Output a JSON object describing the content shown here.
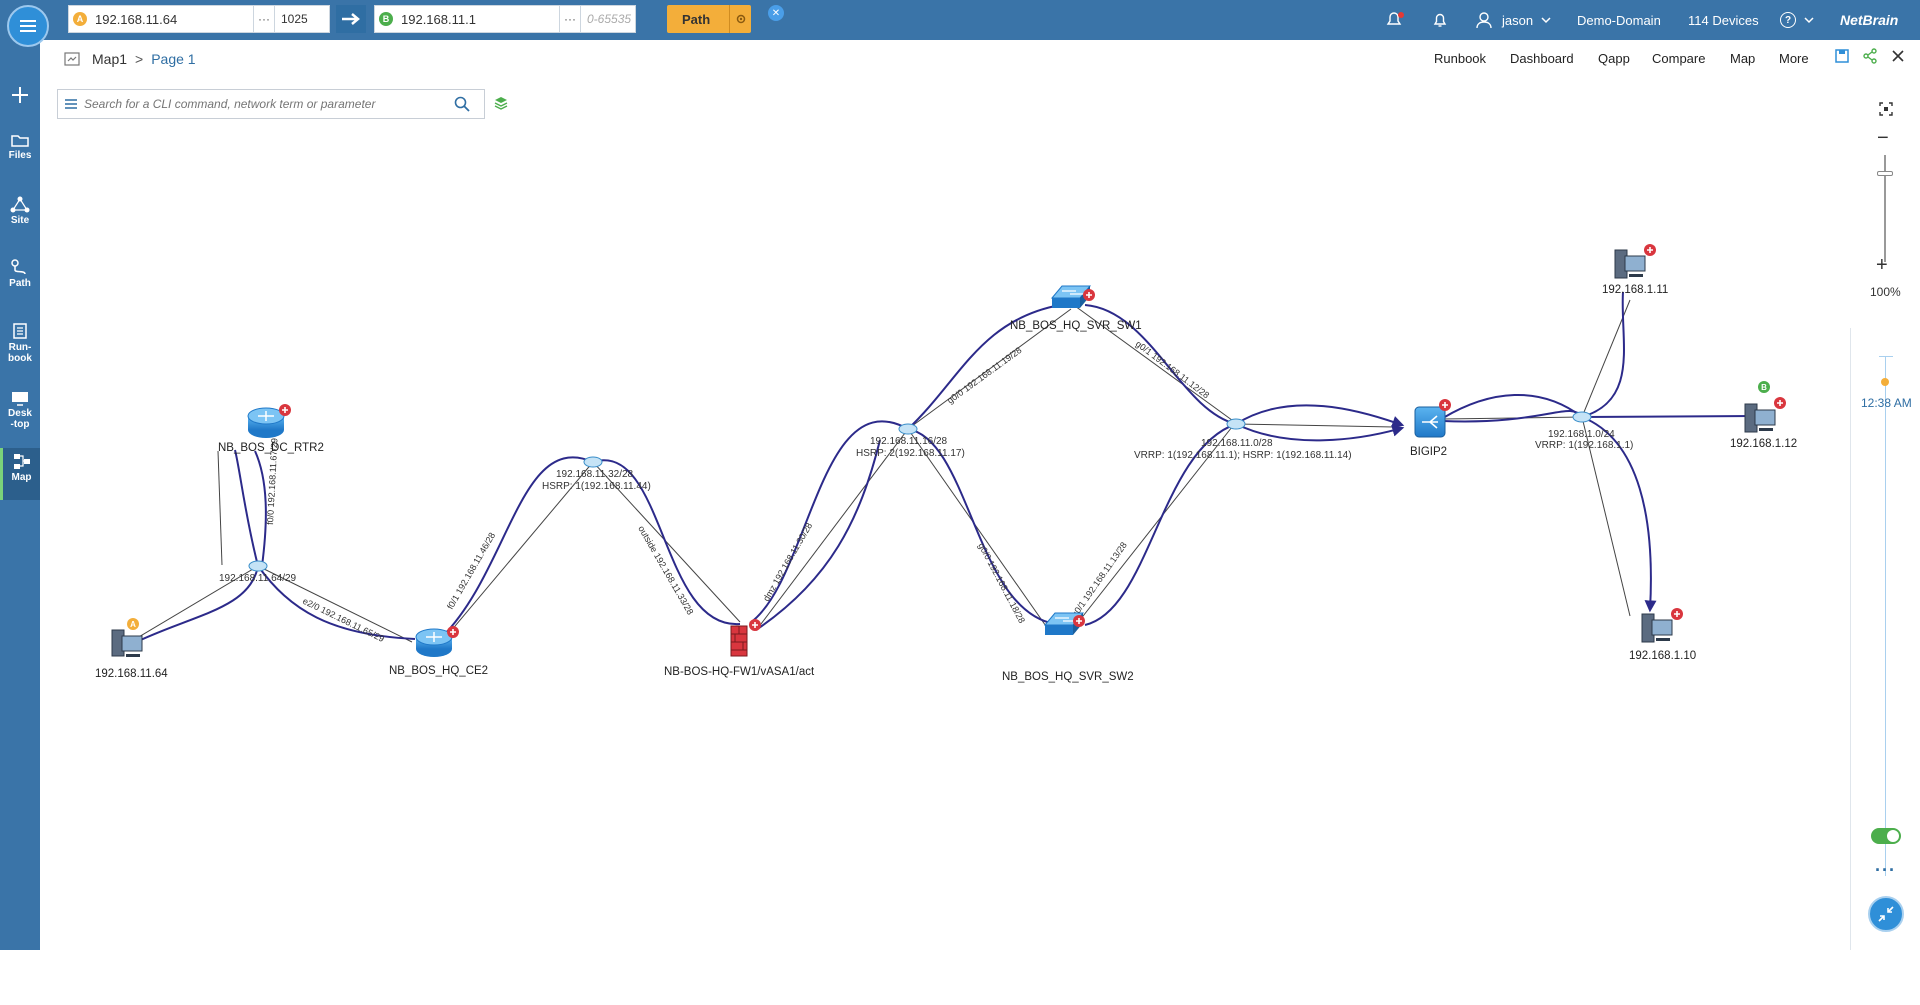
{
  "topbar": {
    "source": {
      "badge": "A",
      "ip": "192.168.11.64",
      "dots": "···",
      "port": "1025"
    },
    "dest": {
      "badge": "B",
      "ip": "192.168.11.1",
      "dots": "···",
      "port_placeholder": "0-65535"
    },
    "path_label": "Path",
    "close_label": "✕",
    "user": "jason",
    "domain": "Demo-Domain",
    "devices": "114 Devices",
    "help": "?",
    "logo": "NetBrain"
  },
  "sidebar": {
    "items": [
      {
        "label": "Files"
      },
      {
        "label": "Site"
      },
      {
        "label": "Path"
      },
      {
        "label": "Run-\nbook"
      },
      {
        "label": "Desk\n-top"
      },
      {
        "label": "Map"
      }
    ]
  },
  "breadcrumb": {
    "map": "Map1",
    "sep": ">",
    "page": "Page 1"
  },
  "toolbar": {
    "items": [
      "Runbook",
      "Dashboard",
      "Qapp",
      "Compare",
      "Map",
      "More"
    ]
  },
  "search": {
    "placeholder": "Search for a CLI command, network term or parameter"
  },
  "zoom": {
    "minus": "−",
    "plus": "+",
    "level": "100%"
  },
  "timeline": {
    "time": "12:38 AM",
    "more": "···"
  },
  "colors": {
    "topbar": "#3a74a8",
    "path_button": "#f3ae3a",
    "link": "#2c2a8a",
    "accent": "#2f8fd8"
  },
  "map": {
    "devices": [
      {
        "id": "pc-a",
        "label": "192.168.11.64",
        "icon": "pc-icon",
        "badge": "A"
      },
      {
        "id": "rtr2",
        "label": "NB_BOS_DC_RTR2",
        "icon": "router-icon"
      },
      {
        "id": "ce2",
        "label": "NB_BOS_HQ_CE2",
        "icon": "router-icon"
      },
      {
        "id": "fw1",
        "label": "NB-BOS-HQ-FW1/vASA1/act",
        "icon": "firewall-icon"
      },
      {
        "id": "sw1",
        "label": "NB_BOS_HQ_SVR_SW1",
        "icon": "switch-icon"
      },
      {
        "id": "sw2",
        "label": "NB_BOS_HQ_SVR_SW2",
        "icon": "switch-icon"
      },
      {
        "id": "bigip2",
        "label": "BIGIP2",
        "icon": "loadbalancer-icon"
      },
      {
        "id": "s11",
        "label": "192.168.1.11",
        "icon": "server-icon"
      },
      {
        "id": "s12",
        "label": "192.168.1.12",
        "icon": "server-icon",
        "badge": "B"
      },
      {
        "id": "s10",
        "label": "192.168.1.10",
        "icon": "server-icon"
      }
    ],
    "networks": [
      {
        "id": "n64",
        "lines": [
          "192.168.11.64/29"
        ]
      },
      {
        "id": "n32",
        "lines": [
          "192.168.11.32/28",
          "HSRP: 1(192.168.11.44)"
        ]
      },
      {
        "id": "n16",
        "lines": [
          "192.168.11.16/28",
          "HSRP: 2(192.168.11.17)"
        ]
      },
      {
        "id": "n0",
        "lines": [
          "192.168.11.0/28",
          "VRRP: 1(192.168.11.1); HSRP: 1(192.168.11.14)"
        ]
      },
      {
        "id": "n1",
        "lines": [
          "192.168.1.0/24",
          "VRRP: 1(192.168.1.1)"
        ]
      }
    ],
    "link_labels": [
      "f0/0 192.168.11.67/29",
      "e2/0 192.168.11.65/29",
      "f0/1 192.168.11.46/28",
      "outside 192.168.11.33/28",
      "dmz 192.168.11.30/28",
      "g0/0 192.168.11.19/28",
      "g0/1 192.168.11.12/28",
      "g0/0 192.168.11.18/28",
      "g0/1 192.168.11.13/28"
    ]
  }
}
